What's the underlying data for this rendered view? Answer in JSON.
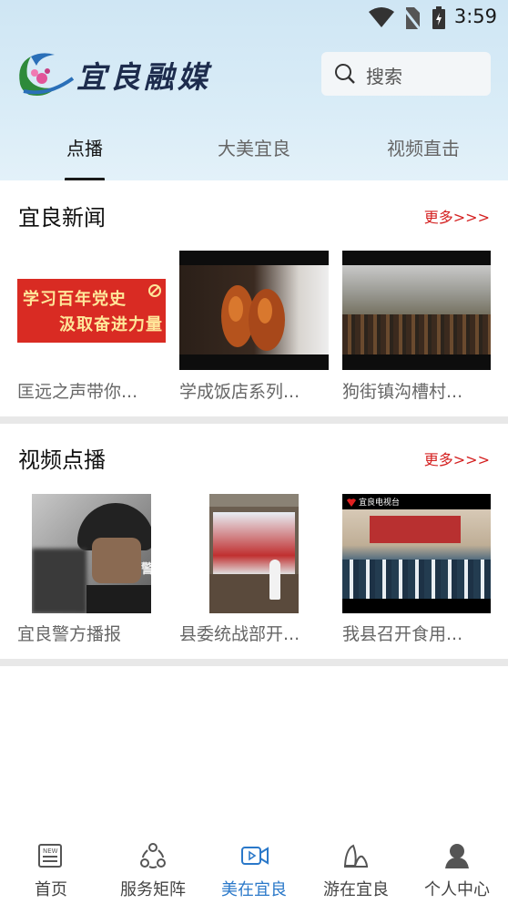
{
  "status_bar": {
    "time": "3:59"
  },
  "header": {
    "logo_text": "宜良融媒",
    "search_placeholder": "搜索"
  },
  "tabs": [
    {
      "label": "点播",
      "active": true
    },
    {
      "label": "大美宜良",
      "active": false
    },
    {
      "label": "视频直击",
      "active": false
    }
  ],
  "sections": [
    {
      "title": "宜良新闻",
      "more": "更多>>>",
      "items": [
        {
          "caption": "匡远之声带你...",
          "banner_line1": "学习百年党史",
          "banner_line2": "汲取奋进力量"
        },
        {
          "caption": "学成饭店系列..."
        },
        {
          "caption": "狗街镇沟槽村..."
        }
      ]
    },
    {
      "title": "视频点播",
      "more": "更多>>>",
      "items": [
        {
          "caption": "宜良警方播报",
          "badge": "警"
        },
        {
          "caption": "县委统战部开..."
        },
        {
          "caption": "我县召开食用...",
          "station": "宜良电视台"
        }
      ]
    }
  ],
  "bottom_nav": [
    {
      "label": "首页",
      "icon": "news-icon",
      "active": false
    },
    {
      "label": "服务矩阵",
      "icon": "service-matrix-icon",
      "active": false
    },
    {
      "label": "美在宜良",
      "icon": "video-camera-icon",
      "active": true
    },
    {
      "label": "游在宜良",
      "icon": "mountain-icon",
      "active": false
    },
    {
      "label": "个人中心",
      "icon": "user-icon",
      "active": false
    }
  ],
  "colors": {
    "accent": "#2a78c9",
    "more_link": "#d42020",
    "header_bg": "#d9ecf7"
  }
}
